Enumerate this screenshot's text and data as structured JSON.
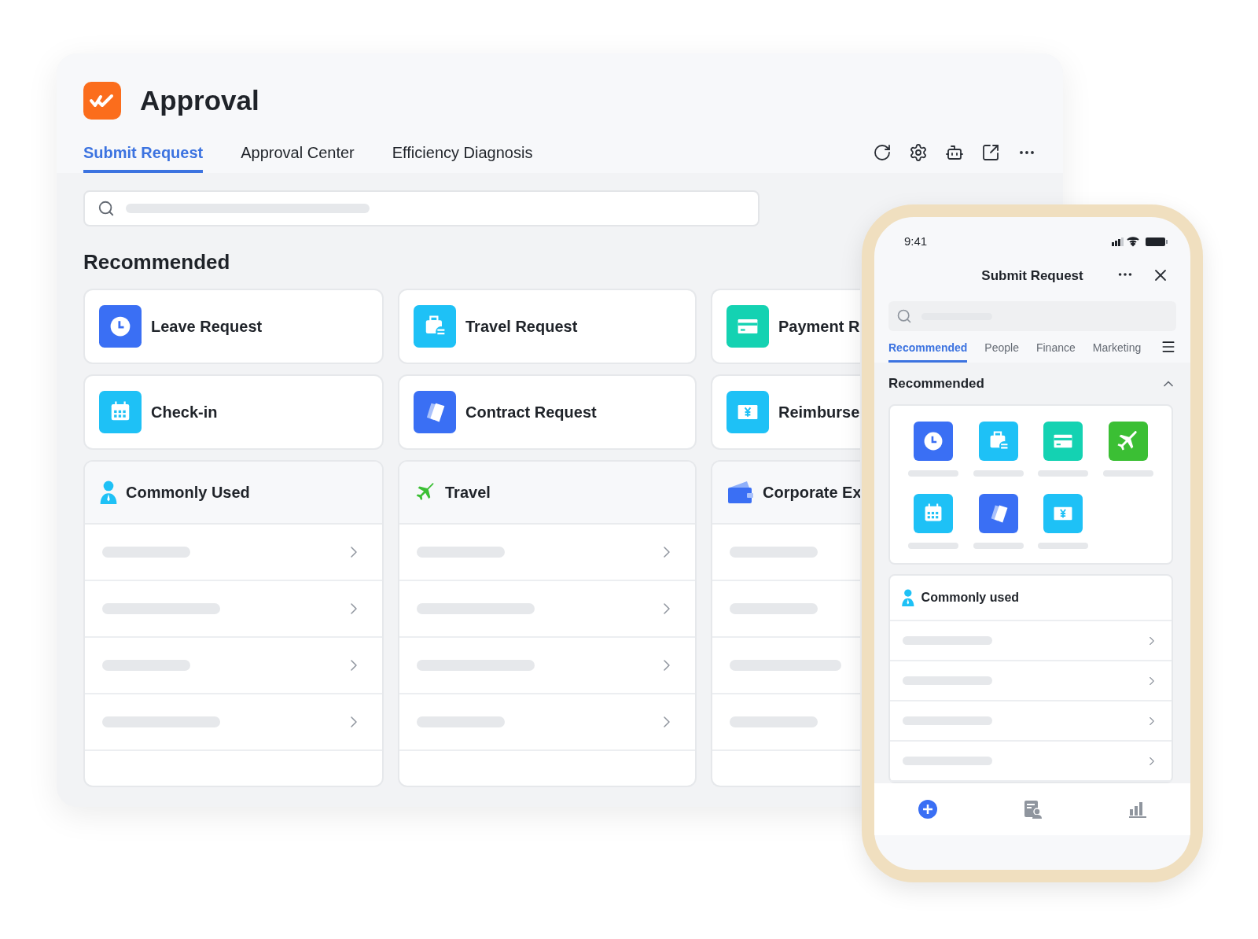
{
  "app": {
    "title": "Approval"
  },
  "tabs": [
    {
      "label": "Submit Request",
      "selected": true
    },
    {
      "label": "Approval Center",
      "selected": false
    },
    {
      "label": "Efficiency Diagnosis",
      "selected": false
    }
  ],
  "section_title": "Recommended",
  "shortcuts": [
    {
      "label": "Leave Request",
      "kind": "clock"
    },
    {
      "label": "Travel Request",
      "kind": "briefcase"
    },
    {
      "label": "Payment R",
      "kind": "card"
    },
    {
      "label": "Check-in",
      "kind": "calendar"
    },
    {
      "label": "Contract Request",
      "kind": "contract"
    },
    {
      "label": "Reimburse",
      "kind": "yen"
    }
  ],
  "groups": [
    {
      "title": "Commonly Used",
      "kind": "person"
    },
    {
      "title": "Travel",
      "kind": "plane"
    },
    {
      "title": "Corporate Ex",
      "kind": "wallet"
    }
  ],
  "phone": {
    "time": "9:41",
    "title": "Submit Request",
    "tabs": [
      {
        "label": "Recommended",
        "selected": true
      },
      {
        "label": "People",
        "selected": false
      },
      {
        "label": "Finance",
        "selected": false
      },
      {
        "label": "Marketing",
        "selected": false
      }
    ],
    "section_title": "Recommended",
    "expanded": true,
    "apps": [
      {
        "kind": "clock"
      },
      {
        "kind": "briefcase"
      },
      {
        "kind": "card"
      },
      {
        "kind": "plane"
      },
      {
        "kind": "calendar"
      },
      {
        "kind": "contract"
      },
      {
        "kind": "yen"
      }
    ],
    "group_title": "Commonly used"
  }
}
